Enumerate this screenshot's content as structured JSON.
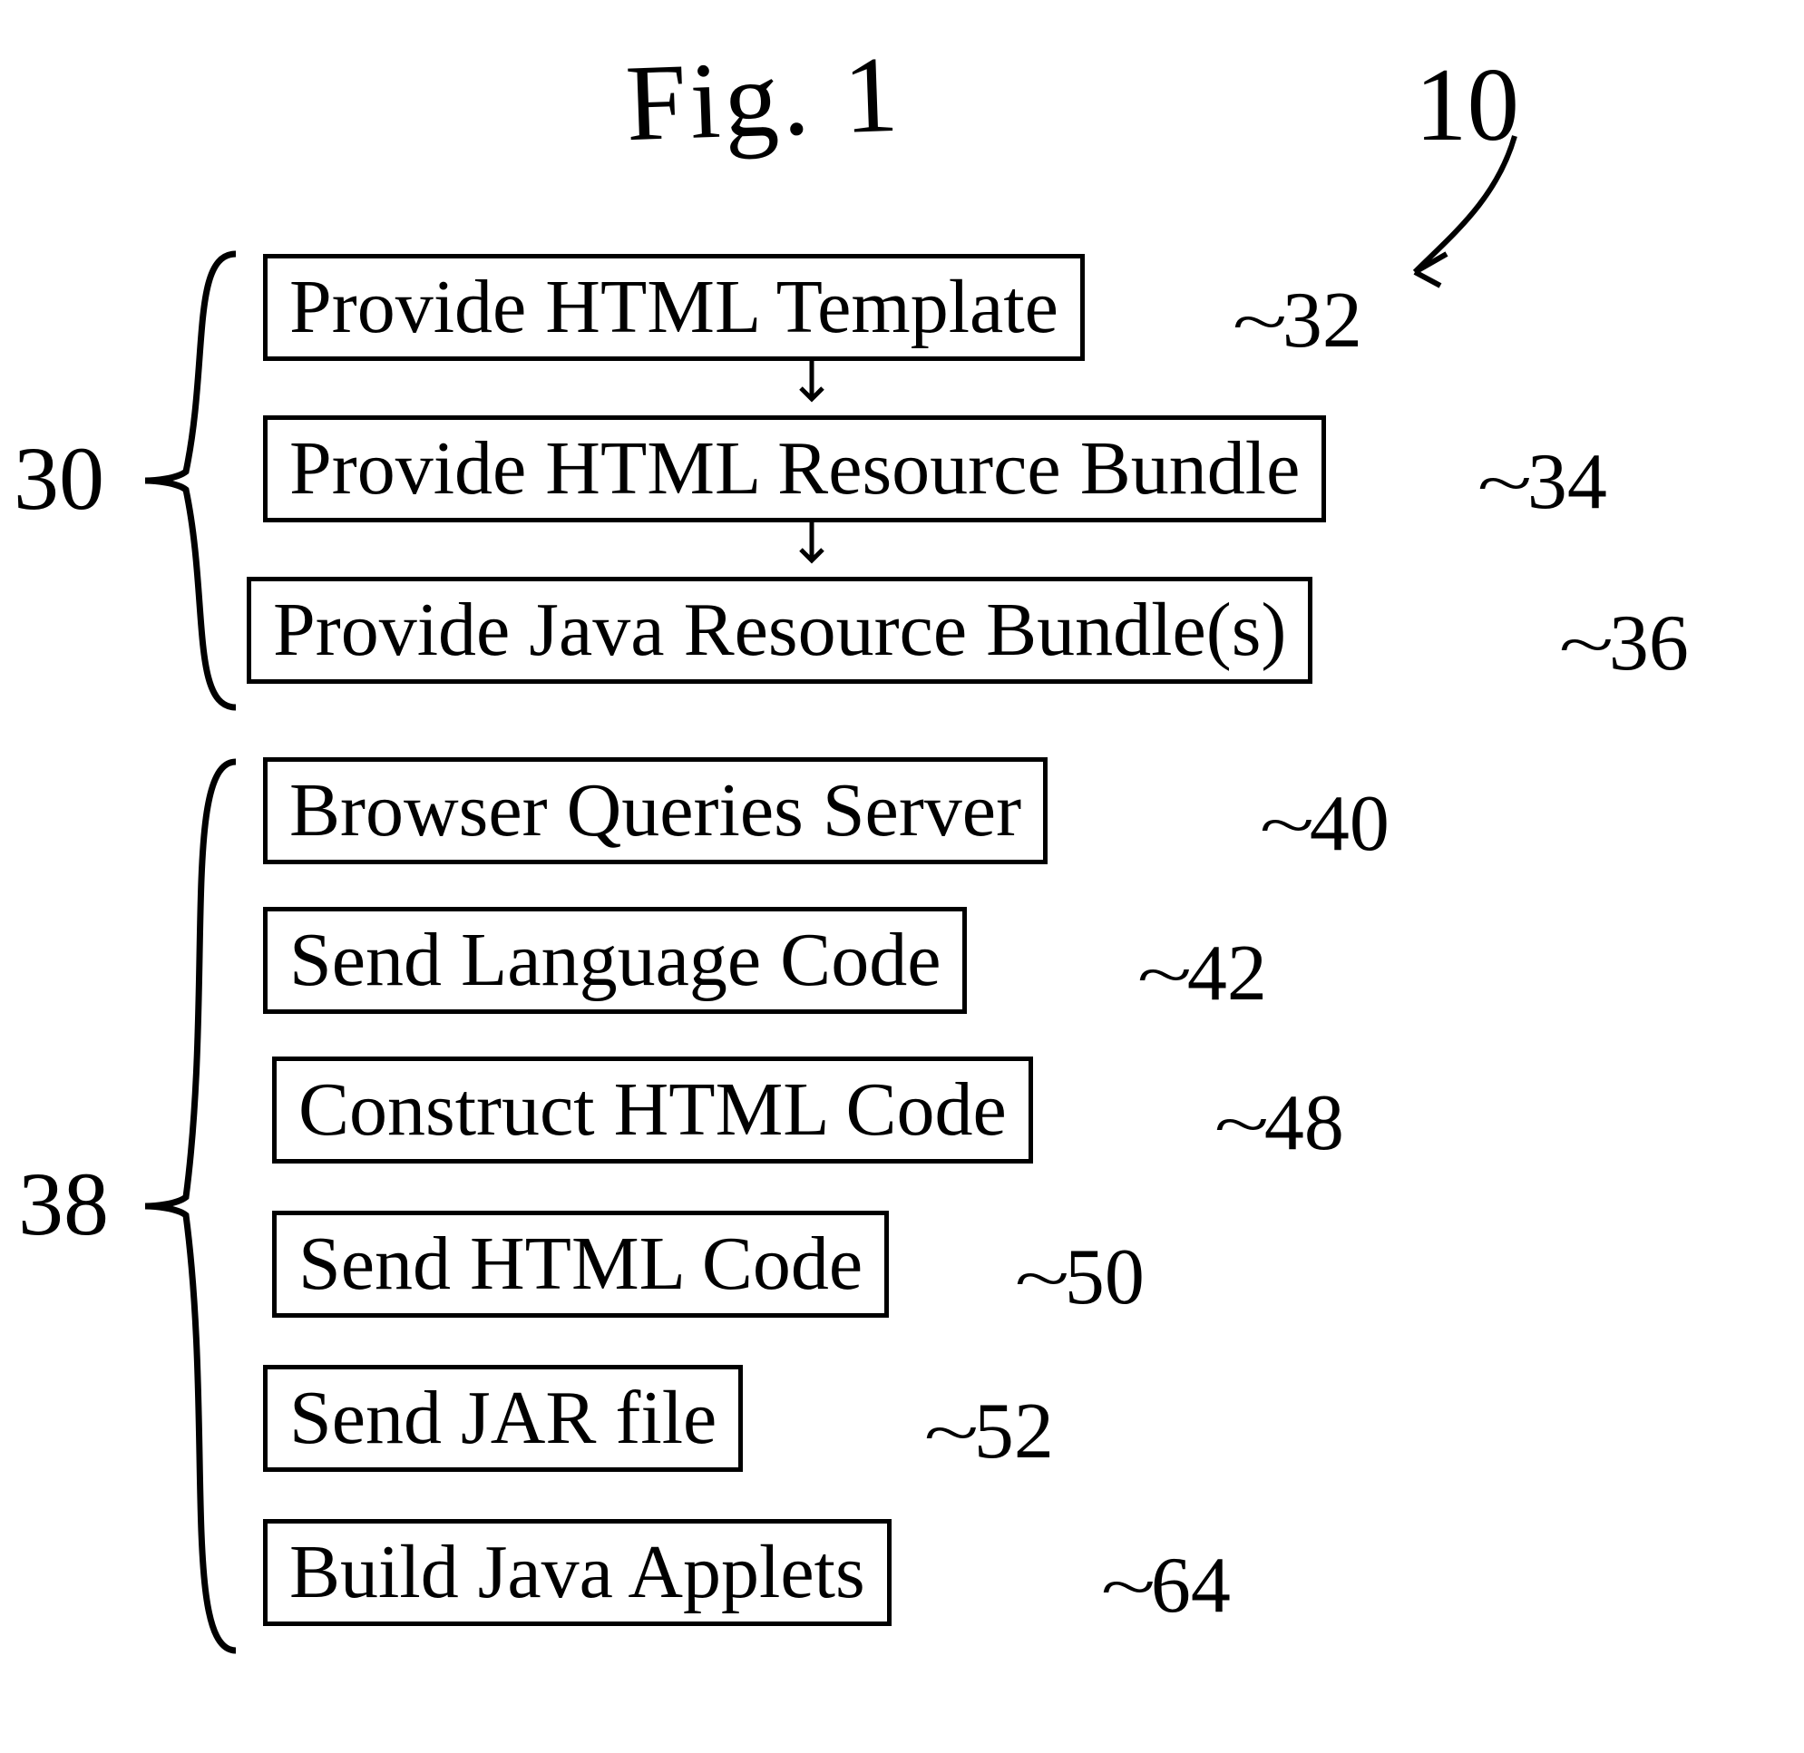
{
  "figure": {
    "title": "Fig. 1",
    "main_ref": "10"
  },
  "group1": {
    "label": "30",
    "steps": [
      {
        "text": "Provide HTML Template",
        "ref": "32"
      },
      {
        "text": "Provide HTML Resource Bundle",
        "ref": "34"
      },
      {
        "text": "Provide Java Resource Bundle(s)",
        "ref": "36"
      }
    ]
  },
  "group2": {
    "label": "38",
    "steps": [
      {
        "text": "Browser Queries Server",
        "ref": "40"
      },
      {
        "text": "Send Language Code",
        "ref": "42"
      },
      {
        "text": "Construct HTML Code",
        "ref": "48"
      },
      {
        "text": "Send HTML Code",
        "ref": "50"
      },
      {
        "text": "Send JAR file",
        "ref": "52"
      },
      {
        "text": "Build Java Applets",
        "ref": "64"
      }
    ]
  }
}
